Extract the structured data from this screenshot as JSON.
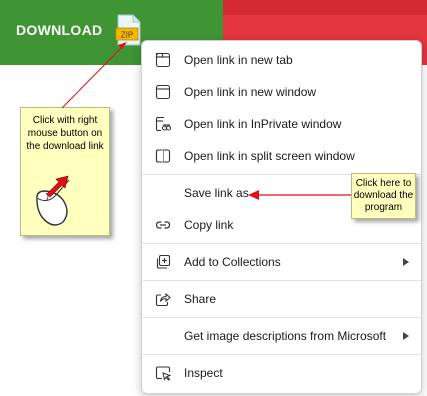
{
  "banner": {
    "download_label": "DOWNLOAD",
    "zip_text": "ZIP",
    "green": "#3f9434",
    "red": "#e3363f"
  },
  "tooltip": {
    "text": "Click with right mouse button on the download link"
  },
  "callout": {
    "text": "Click here to download the program"
  },
  "menu": {
    "items": [
      {
        "label": "Open link in new tab",
        "icon": "new-tab-icon"
      },
      {
        "label": "Open link in new window",
        "icon": "new-window-icon"
      },
      {
        "label": "Open link in InPrivate window",
        "icon": "inprivate-window-icon"
      },
      {
        "label": "Open link in split screen window",
        "icon": "split-screen-icon"
      },
      {
        "label": "Save link as",
        "icon": ""
      },
      {
        "label": "Copy link",
        "icon": "link-icon"
      },
      {
        "label": "Add to Collections",
        "icon": "collections-icon",
        "submenu": true
      },
      {
        "label": "Share",
        "icon": "share-icon"
      },
      {
        "label": "Get image descriptions from Microsoft",
        "icon": "",
        "submenu": true
      },
      {
        "label": "Inspect",
        "icon": "inspect-icon"
      }
    ]
  },
  "annotation_color": "#e0101b"
}
